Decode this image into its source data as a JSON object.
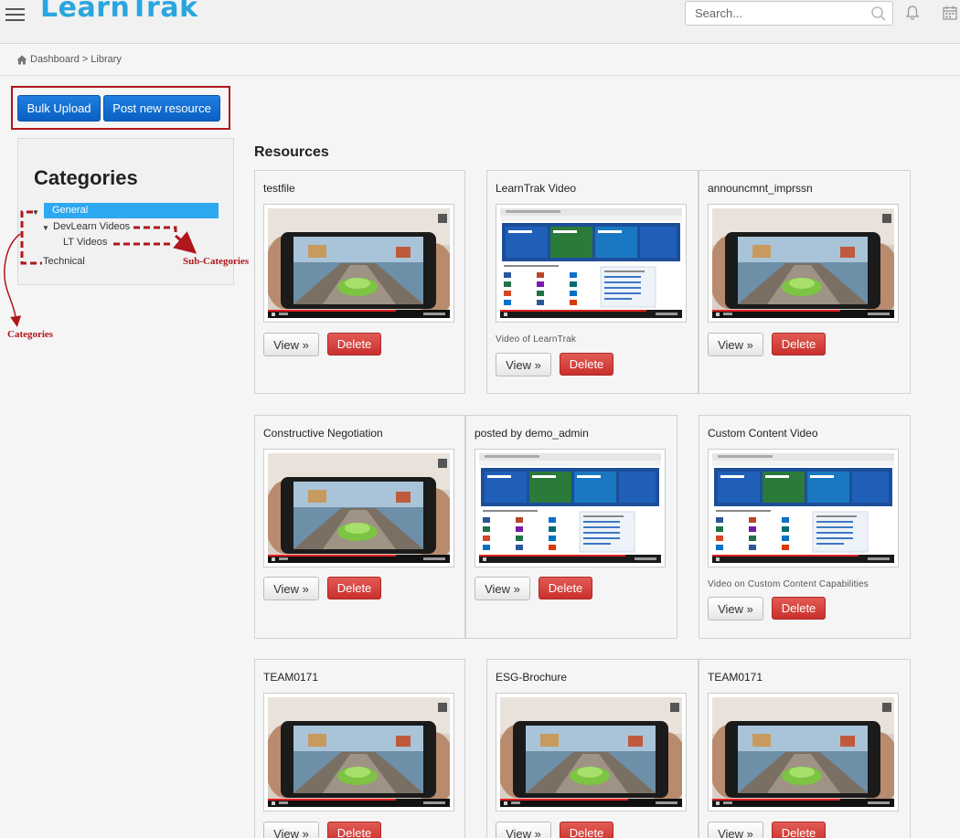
{
  "header": {
    "app_name": "LearnTrak",
    "search_placeholder": "Search...",
    "brand_color": "#2aa6df"
  },
  "breadcrumb": {
    "home": "Dashboard",
    "separator": ">",
    "current": "Library"
  },
  "actions": {
    "bulk_upload": "Bulk Upload",
    "post_new": "Post new resource"
  },
  "categories": {
    "title": "Categories",
    "items": [
      {
        "label": "General",
        "selected": true
      },
      {
        "label": "DevLearn Videos"
      },
      {
        "label": "LT Videos"
      },
      {
        "label": "Technical"
      }
    ]
  },
  "annotations": {
    "sub_categories": "Sub-Categories",
    "categories": "Categories"
  },
  "resources": {
    "heading": "Resources",
    "view_label": "View »",
    "delete_label": "Delete",
    "items": [
      {
        "title": "testfile",
        "thumbnail": "game-video",
        "description": ""
      },
      {
        "title": "LearnTrak Video",
        "thumbnail": "office-page",
        "description": "Video of LearnTrak"
      },
      {
        "title": "announcmnt_imprssn",
        "thumbnail": "game-video",
        "description": ""
      },
      {
        "title": "Constructive Negotiation",
        "thumbnail": "game-video",
        "description": ""
      },
      {
        "title": "posted by demo_admin",
        "thumbnail": "office-page",
        "description": ""
      },
      {
        "title": "Custom Content Video",
        "thumbnail": "office-page",
        "description": "Video on Custom Content Capabilities"
      },
      {
        "title": "TEAM0171",
        "thumbnail": "game-video",
        "description": ""
      },
      {
        "title": "ESG-Brochure",
        "thumbnail": "game-video",
        "description": ""
      },
      {
        "title": "TEAM0171",
        "thumbnail": "game-video",
        "description": ""
      }
    ]
  }
}
